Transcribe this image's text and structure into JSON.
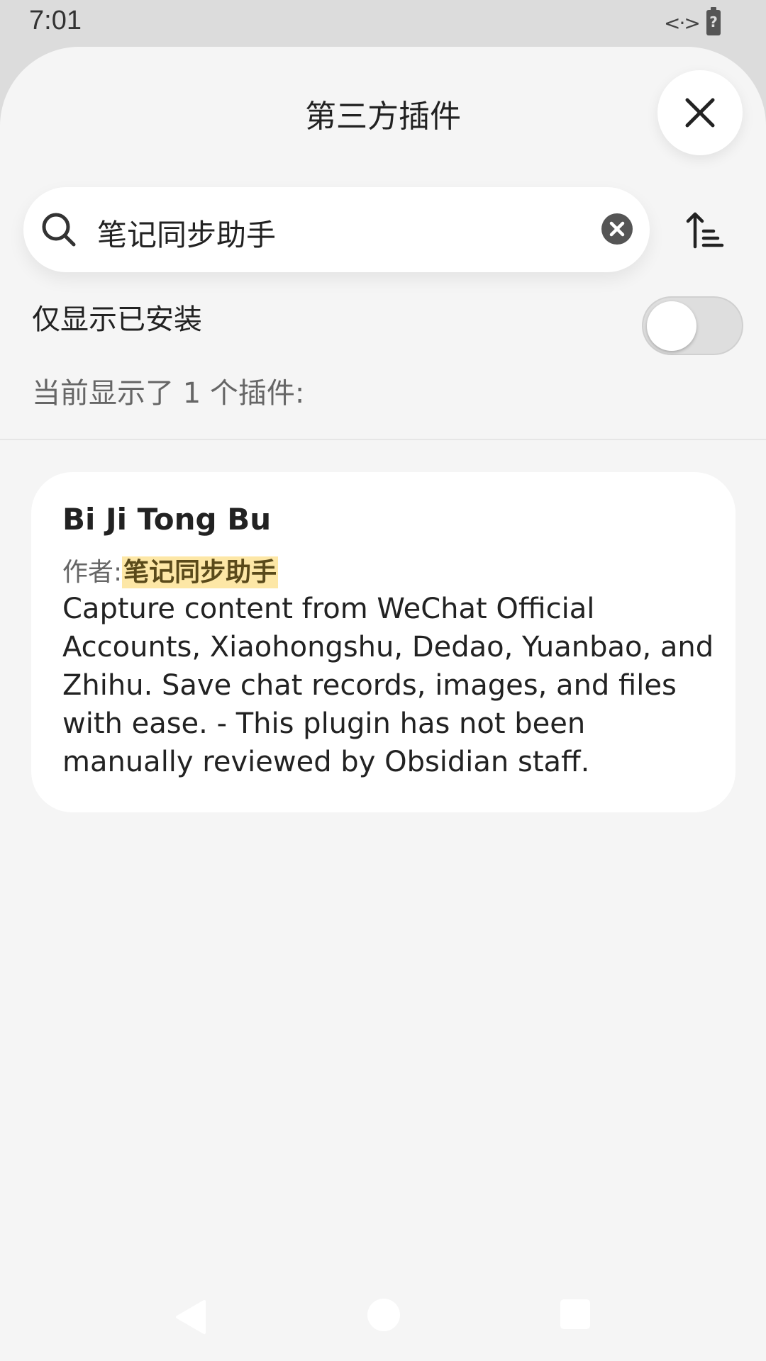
{
  "status_bar": {
    "time": "7:01",
    "data_indicator": "<·>",
    "battery_glyph": "?"
  },
  "sheet": {
    "title": "第三方插件"
  },
  "search": {
    "value": "笔记同步助手"
  },
  "filters": {
    "installed_only_label": "仅显示已安装",
    "installed_only_enabled": false
  },
  "results": {
    "count_text": "当前显示了 1 个插件:"
  },
  "plugins": [
    {
      "name": "Bi Ji Tong Bu",
      "author_label": "作者:",
      "author": "笔记同步助手",
      "description": "Capture content from WeChat Official Accounts, Xiaohongshu, Dedao, Yuanbao, and Zhihu. Save chat records, images, and files with ease. - This plugin has not been manually reviewed by Obsidian staff."
    }
  ],
  "colors": {
    "background": "#f5f5f5",
    "card": "#ffffff",
    "highlight": "#fde7a6",
    "toggle_off": "#dedede"
  },
  "icons": [
    "search-icon",
    "clear-icon",
    "close-icon",
    "sort-icon",
    "back-icon",
    "home-icon",
    "recents-icon"
  ]
}
